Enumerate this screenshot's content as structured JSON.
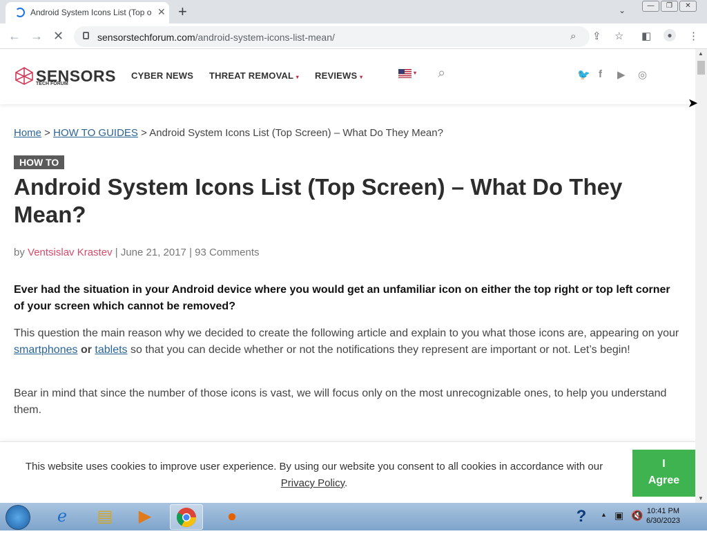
{
  "browser": {
    "tab_title": "Android System Icons List (Top of Screen)",
    "tab_close": "✕",
    "new_tab": "+",
    "url_domain": "sensorstechforum.com",
    "url_path": "/android-system-icons-list-mean/",
    "window_controls": [
      "▭",
      "❐",
      "✕"
    ]
  },
  "site": {
    "logo_word": "SENSORS",
    "logo_sub": "TECH FORUM",
    "nav": [
      "CYBER NEWS",
      "THREAT REMOVAL",
      "REVIEWS"
    ],
    "search_icon": "🔍"
  },
  "article": {
    "breadcrumb": {
      "home": "Home",
      "sep1": " > ",
      "guides": "HOW TO GUIDES",
      "sep2": " > ",
      "current": "Android System Icons List (Top Screen) – What Do They Mean?"
    },
    "badge": "HOW TO",
    "title": "Android System Icons List (Top Screen) – What Do They Mean?",
    "meta": {
      "by": "by ",
      "author": "Ventsislav Krastev",
      "date": "June 21, 2017",
      "comments": "93 Comments",
      "sep": "  |  "
    },
    "lead": "Ever had the situation in your Android device where you would get an unfamiliar icon on either the top right or top left corner of your screen which cannot be removed?",
    "p1": {
      "a": "This question the main reason why we decided to create the following article and explain to you what those icons are, appearing on your ",
      "link1": "smartphones",
      "or": " or ",
      "link2": "tablets",
      "b": " so that you can decide whether or not the notifications they represent are important or not. Let’s begin!"
    },
    "p2": "Bear in mind that since the number of those icons is vast, we will focus only on the most unrecognizable ones, to help you understand them."
  },
  "cookie": {
    "text": "This website uses cookies to improve user experience. By using our website you consent to all cookies in accordance with our",
    "link": "Privacy Policy",
    "period": ".",
    "agree_line1": "I",
    "agree_line2": "Agree"
  },
  "taskbar": {
    "time": "10:41 PM",
    "date": "6/30/2023"
  },
  "colors": {
    "accent_pink": "#d84a6a",
    "agree_green": "#3fb34f",
    "link_blue": "#2a6496"
  }
}
